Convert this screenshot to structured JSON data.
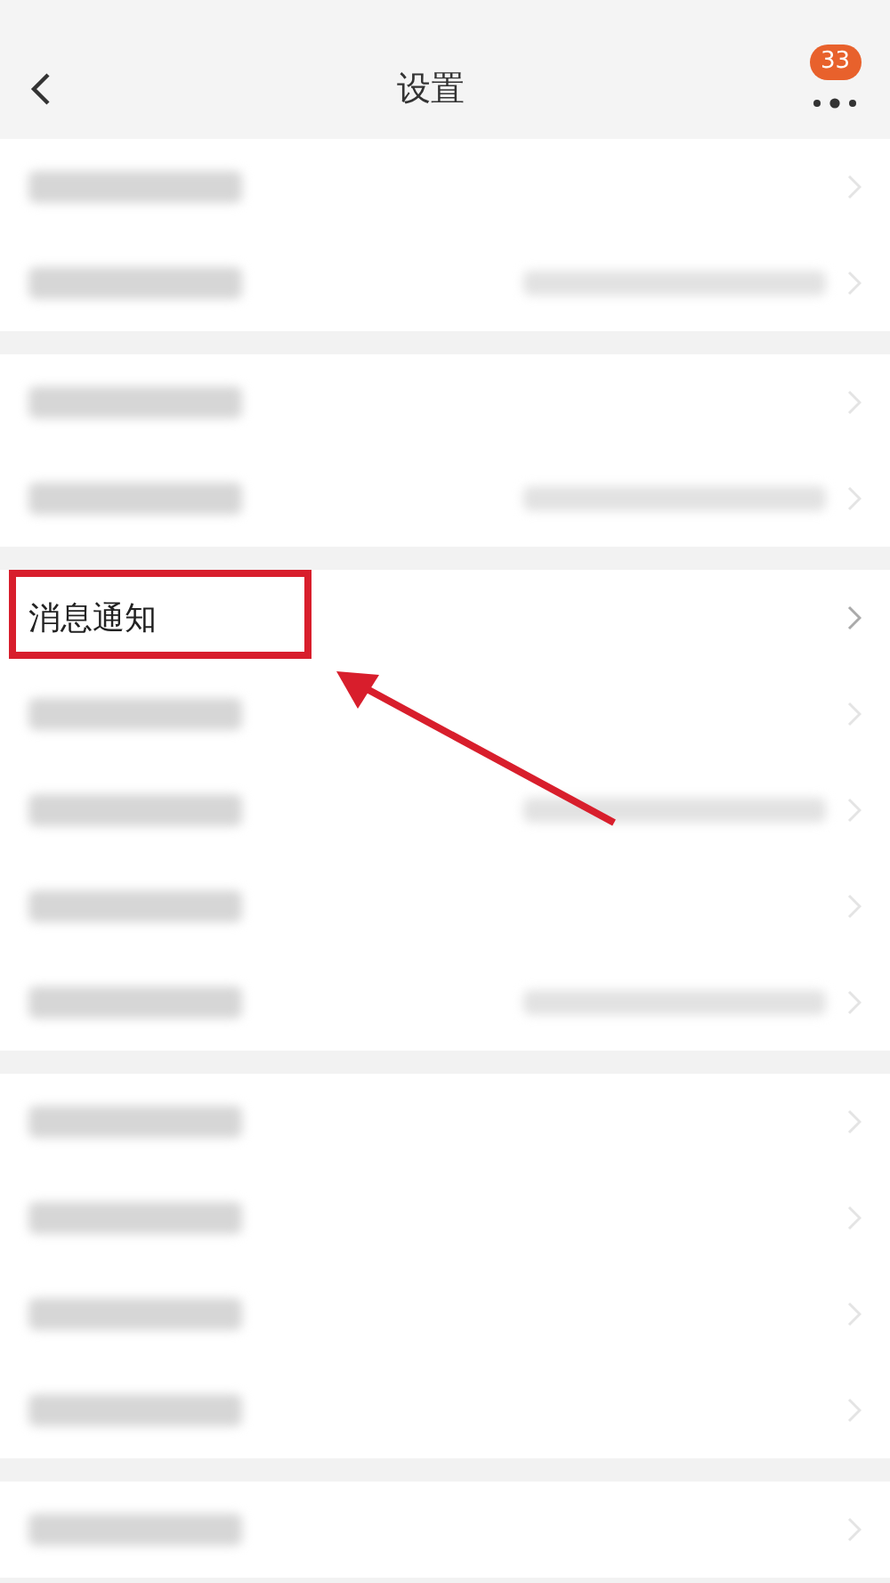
{
  "header": {
    "title": "设置",
    "badge": "33"
  },
  "groups": [
    {
      "rows": [
        {
          "kind": "blurred",
          "has_value": false
        },
        {
          "kind": "blurred",
          "has_value": true
        }
      ]
    },
    {
      "rows": [
        {
          "kind": "blurred",
          "has_value": false
        },
        {
          "kind": "blurred",
          "has_value": true
        }
      ]
    },
    {
      "rows": [
        {
          "kind": "text",
          "label": "消息通知",
          "highlighted": true
        },
        {
          "kind": "blurred",
          "has_value": false
        },
        {
          "kind": "blurred",
          "has_value": true
        },
        {
          "kind": "blurred",
          "has_value": false
        },
        {
          "kind": "blurred",
          "has_value": true
        }
      ]
    },
    {
      "rows": [
        {
          "kind": "blurred",
          "has_value": false
        },
        {
          "kind": "blurred",
          "has_value": false
        },
        {
          "kind": "blurred",
          "has_value": false
        },
        {
          "kind": "blurred",
          "has_value": false
        }
      ]
    },
    {
      "rows": [
        {
          "kind": "blurred",
          "has_value": false
        }
      ]
    }
  ],
  "annotation": {
    "arrow": true
  }
}
